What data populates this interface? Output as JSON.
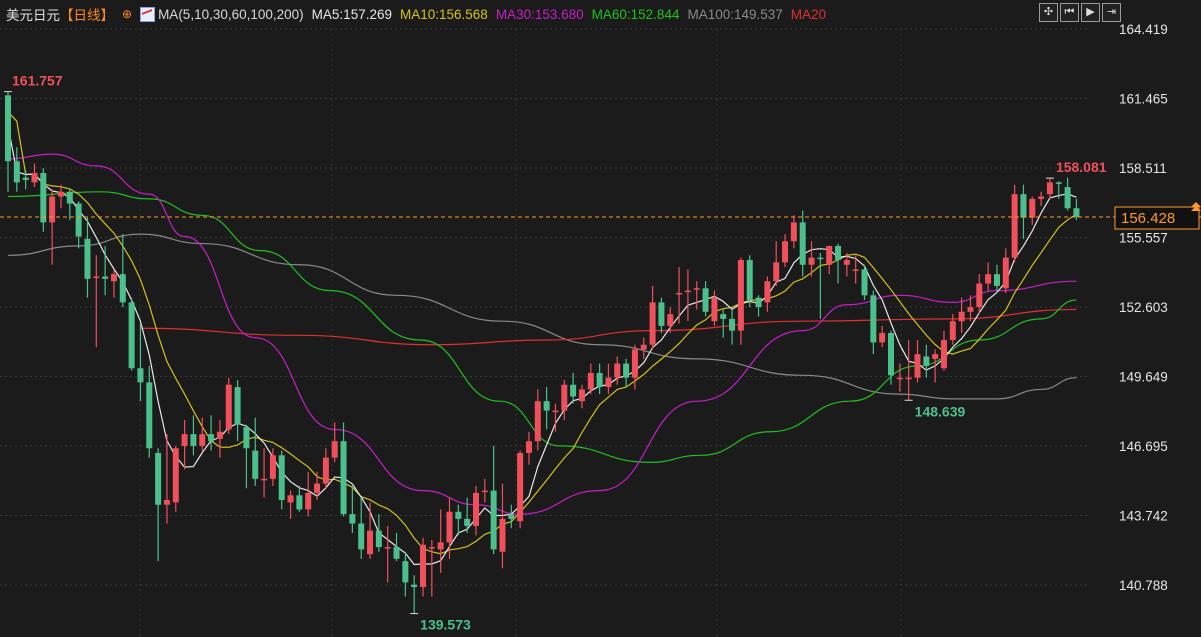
{
  "header": {
    "symbol": "美元日元",
    "period": "【日线】",
    "target_icon": "crosshair-target-icon",
    "ma_icon": "ma-indicator-icon",
    "ma_params": "MA(5,10,30,60,100,200)",
    "ma5": "MA5:157.269",
    "ma10": "MA10:156.568",
    "ma30": "MA30:153.680",
    "ma60": "MA60:152.844",
    "ma100": "MA100:149.537",
    "ma20": "MA20"
  },
  "toolbar": [
    {
      "icon": "crosshair-icon",
      "glyph": "✣"
    },
    {
      "icon": "jump-start-icon",
      "glyph": "⏮"
    },
    {
      "icon": "play-icon",
      "glyph": "▶"
    },
    {
      "icon": "jump-end-icon",
      "glyph": "⇥"
    }
  ],
  "colors": {
    "up": "#f0505c",
    "down": "#4cc08c",
    "ma5": "#e8e8e8",
    "ma10": "#d4c21a",
    "ma30": "#c81ec8",
    "ma60": "#20c020",
    "ma100": "#8a8a8a",
    "ma20": "#e03030",
    "last": "#ff9a2a",
    "bg": "#1b1b1b"
  },
  "last_price": "156.428",
  "chart_data": {
    "type": "candlestick",
    "title": "美元日元 日线",
    "ylim": [
      140.788,
      164.419
    ],
    "yticks": [
      "164.419",
      "161.465",
      "158.511",
      "155.557",
      "152.603",
      "149.649",
      "146.695",
      "143.742",
      "140.788"
    ],
    "grid": true,
    "annotations": [
      {
        "label": "161.757",
        "index": 0,
        "price": 161.757,
        "kind": "high"
      },
      {
        "label": "139.573",
        "index": 46,
        "price": 139.573,
        "kind": "low"
      },
      {
        "label": "148.639",
        "index": 102,
        "price": 148.639,
        "kind": "low"
      },
      {
        "label": "158.081",
        "index": 118,
        "price": 158.081,
        "kind": "high"
      }
    ],
    "ohlc": [
      [
        161.6,
        161.757,
        157.5,
        158.8
      ],
      [
        158.8,
        159.4,
        157.5,
        157.9
      ],
      [
        158.1,
        158.4,
        157.6,
        158.0
      ],
      [
        157.9,
        158.7,
        157.7,
        158.3
      ],
      [
        158.3,
        158.5,
        155.8,
        156.2
      ],
      [
        156.2,
        157.6,
        154.4,
        157.3
      ],
      [
        157.3,
        157.8,
        156.8,
        157.5
      ],
      [
        157.5,
        157.6,
        156.3,
        157.0
      ],
      [
        157.0,
        157.1,
        155.1,
        155.6
      ],
      [
        155.5,
        156.4,
        153.0,
        153.8
      ],
      [
        153.9,
        154.8,
        150.9,
        153.9
      ],
      [
        153.9,
        155.2,
        153.1,
        153.8
      ],
      [
        153.7,
        154.2,
        153.0,
        154.0
      ],
      [
        154.0,
        155.7,
        152.6,
        152.8
      ],
      [
        152.8,
        153.0,
        149.9,
        150.0
      ],
      [
        150.0,
        151.9,
        148.6,
        149.4
      ],
      [
        149.4,
        150.1,
        146.2,
        146.6
      ],
      [
        146.4,
        146.6,
        141.8,
        144.2
      ],
      [
        144.2,
        147.2,
        143.4,
        144.4
      ],
      [
        144.3,
        146.7,
        143.9,
        146.6
      ],
      [
        146.7,
        147.8,
        145.7,
        147.2
      ],
      [
        147.2,
        148.0,
        146.3,
        146.7
      ],
      [
        146.7,
        147.9,
        146.5,
        147.2
      ],
      [
        147.2,
        148.0,
        146.5,
        146.9
      ],
      [
        147.0,
        147.8,
        146.2,
        147.3
      ],
      [
        147.4,
        149.6,
        147.2,
        149.3
      ],
      [
        149.2,
        149.5,
        146.9,
        147.6
      ],
      [
        147.5,
        147.6,
        144.9,
        146.6
      ],
      [
        146.5,
        147.9,
        145.0,
        145.3
      ],
      [
        145.3,
        146.6,
        144.5,
        145.3
      ],
      [
        145.3,
        146.6,
        145.0,
        146.3
      ],
      [
        146.3,
        146.5,
        144.0,
        144.4
      ],
      [
        144.3,
        144.8,
        143.6,
        144.6
      ],
      [
        144.6,
        145.0,
        143.9,
        144.0
      ],
      [
        144.0,
        145.6,
        143.7,
        144.7
      ],
      [
        144.7,
        145.6,
        144.4,
        145.1
      ],
      [
        145.1,
        146.6,
        144.9,
        146.2
      ],
      [
        146.2,
        147.7,
        146.0,
        146.9
      ],
      [
        146.9,
        147.7,
        143.7,
        143.8
      ],
      [
        143.8,
        145.0,
        143.0,
        143.4
      ],
      [
        143.4,
        144.5,
        141.9,
        142.3
      ],
      [
        142.1,
        144.3,
        141.9,
        143.1
      ],
      [
        143.1,
        143.8,
        142.2,
        142.4
      ],
      [
        142.4,
        143.3,
        140.9,
        142.4
      ],
      [
        142.4,
        143.0,
        141.8,
        141.9
      ],
      [
        141.8,
        142.2,
        140.3,
        140.9
      ],
      [
        140.8,
        141.2,
        139.573,
        140.7
      ],
      [
        140.7,
        142.8,
        140.3,
        142.5
      ],
      [
        142.4,
        142.7,
        140.3,
        142.4
      ],
      [
        142.3,
        144.0,
        141.3,
        142.6
      ],
      [
        142.6,
        144.5,
        141.9,
        143.9
      ],
      [
        143.9,
        144.2,
        142.9,
        143.6
      ],
      [
        143.6,
        144.5,
        143.0,
        143.3
      ],
      [
        143.3,
        145.0,
        142.9,
        144.7
      ],
      [
        144.8,
        145.3,
        144.3,
        144.8
      ],
      [
        144.8,
        146.7,
        142.1,
        142.3
      ],
      [
        142.2,
        145.1,
        141.5,
        143.6
      ],
      [
        143.8,
        144.2,
        143.2,
        143.6
      ],
      [
        143.5,
        146.5,
        143.2,
        146.4
      ],
      [
        146.4,
        147.3,
        145.9,
        146.9
      ],
      [
        146.9,
        149.1,
        146.5,
        148.6
      ],
      [
        148.6,
        149.2,
        147.4,
        148.2
      ],
      [
        148.2,
        148.5,
        147.3,
        148.2
      ],
      [
        148.2,
        149.5,
        147.8,
        149.3
      ],
      [
        149.3,
        149.8,
        148.5,
        148.8
      ],
      [
        148.6,
        149.3,
        148.3,
        149.1
      ],
      [
        149.1,
        150.2,
        148.9,
        149.8
      ],
      [
        149.8,
        150.2,
        148.9,
        149.2
      ],
      [
        149.2,
        150.2,
        148.9,
        149.6
      ],
      [
        149.6,
        150.5,
        149.3,
        150.2
      ],
      [
        150.2,
        150.4,
        149.2,
        149.6
      ],
      [
        149.6,
        151.0,
        149.1,
        150.8
      ],
      [
        150.8,
        151.3,
        150.4,
        151.0
      ],
      [
        151.0,
        153.5,
        150.8,
        152.8
      ],
      [
        152.8,
        153.0,
        151.5,
        151.8
      ],
      [
        151.8,
        152.6,
        151.5,
        152.3
      ],
      [
        153.2,
        154.3,
        151.9,
        153.2
      ],
      [
        153.3,
        154.2,
        152.0,
        153.3
      ],
      [
        153.4,
        153.7,
        152.5,
        153.4
      ],
      [
        153.4,
        153.7,
        152.2,
        152.4
      ],
      [
        152.0,
        153.3,
        151.8,
        153.0
      ],
      [
        152.3,
        152.5,
        151.3,
        152.1
      ],
      [
        152.1,
        152.5,
        151.0,
        151.6
      ],
      [
        151.6,
        154.7,
        151.0,
        154.6
      ],
      [
        154.6,
        154.8,
        152.6,
        152.9
      ],
      [
        153.0,
        153.1,
        152.2,
        152.6
      ],
      [
        152.8,
        153.9,
        152.4,
        153.7
      ],
      [
        153.7,
        155.4,
        153.5,
        154.5
      ],
      [
        154.5,
        155.7,
        154.3,
        155.4
      ],
      [
        155.4,
        156.5,
        155.1,
        156.2
      ],
      [
        156.2,
        156.7,
        153.9,
        154.4
      ],
      [
        154.4,
        155.4,
        153.9,
        154.7
      ],
      [
        154.7,
        154.9,
        152.1,
        154.7
      ],
      [
        154.4,
        155.2,
        154.0,
        155.2
      ],
      [
        155.2,
        155.3,
        153.6,
        154.6
      ],
      [
        154.4,
        154.9,
        153.9,
        154.6
      ],
      [
        154.2,
        154.8,
        153.6,
        154.2
      ],
      [
        154.2,
        154.4,
        152.9,
        153.1
      ],
      [
        153.1,
        153.3,
        150.6,
        151.1
      ],
      [
        151.1,
        151.8,
        150.9,
        151.5
      ],
      [
        151.5,
        151.6,
        149.3,
        149.7
      ],
      [
        149.6,
        150.2,
        149.0,
        149.6
      ],
      [
        149.6,
        151.2,
        148.639,
        149.6
      ],
      [
        149.6,
        151.2,
        149.4,
        150.6
      ],
      [
        150.5,
        151.0,
        149.6,
        150.1
      ],
      [
        150.4,
        150.8,
        149.4,
        150.6
      ],
      [
        150.0,
        151.6,
        149.9,
        151.2
      ],
      [
        151.2,
        152.3,
        151.0,
        152.0
      ],
      [
        152.0,
        153.0,
        151.5,
        152.4
      ],
      [
        152.4,
        153.1,
        152.0,
        152.6
      ],
      [
        152.6,
        154.0,
        152.3,
        153.6
      ],
      [
        153.6,
        154.5,
        153.3,
        154.0
      ],
      [
        154.0,
        154.4,
        153.2,
        153.5
      ],
      [
        153.4,
        155.1,
        153.2,
        154.7
      ],
      [
        154.7,
        157.8,
        154.5,
        157.4
      ],
      [
        157.4,
        157.8,
        155.5,
        156.4
      ],
      [
        156.4,
        157.3,
        156.1,
        157.2
      ],
      [
        157.2,
        157.5,
        156.9,
        157.3
      ],
      [
        157.4,
        158.081,
        157.2,
        157.9
      ],
      [
        157.9,
        157.95,
        157.2,
        157.9
      ],
      [
        157.7,
        158.1,
        156.7,
        156.8
      ],
      [
        156.8,
        157.2,
        156.3,
        156.428
      ]
    ],
    "ma_series": {
      "ma30": [
        [
          0,
          158.9
        ],
        [
          5,
          159.1
        ],
        [
          10,
          158.6
        ],
        [
          16,
          157.4
        ],
        [
          20,
          155.6
        ],
        [
          28,
          151.3
        ],
        [
          37,
          147.4
        ],
        [
          47,
          144.8
        ],
        [
          53,
          144.2
        ],
        [
          58,
          143.8
        ],
        [
          67,
          144.8
        ],
        [
          78,
          148.6
        ],
        [
          90,
          151.6
        ],
        [
          95,
          152.7
        ],
        [
          101,
          153.1
        ],
        [
          107,
          152.8
        ],
        [
          112,
          153.3
        ],
        [
          121,
          153.7
        ]
      ],
      "ma60": [
        [
          0,
          157.3
        ],
        [
          10.5,
          157.5
        ],
        [
          16,
          157.2
        ],
        [
          22,
          156.5
        ],
        [
          28.6,
          155.0
        ],
        [
          36.5,
          153.3
        ],
        [
          46.7,
          151.2
        ],
        [
          55.7,
          148.6
        ],
        [
          62.5,
          146.7
        ],
        [
          72.7,
          146.0
        ],
        [
          78.4,
          146.3
        ],
        [
          86.3,
          147.3
        ],
        [
          95.4,
          148.6
        ],
        [
          103,
          150.1
        ],
        [
          110,
          151.2
        ],
        [
          117,
          152.1
        ],
        [
          121,
          152.9
        ]
      ],
      "ma100": [
        [
          0,
          154.8
        ],
        [
          8,
          155.2
        ],
        [
          15,
          155.7
        ],
        [
          22,
          155.3
        ],
        [
          33,
          154.4
        ],
        [
          44,
          153.1
        ],
        [
          56,
          152.0
        ],
        [
          67,
          151.0
        ],
        [
          78,
          150.4
        ],
        [
          90,
          149.7
        ],
        [
          101,
          148.9
        ],
        [
          107,
          148.7
        ],
        [
          112,
          148.7
        ],
        [
          117,
          149.1
        ],
        [
          121,
          149.6
        ]
      ],
      "ma20": [
        [
          15,
          151.7
        ],
        [
          33,
          151.4
        ],
        [
          48,
          151.0
        ],
        [
          61,
          151.2
        ],
        [
          73,
          151.6
        ],
        [
          90,
          152.0
        ],
        [
          107,
          152.1
        ],
        [
          121,
          152.5
        ]
      ]
    }
  }
}
